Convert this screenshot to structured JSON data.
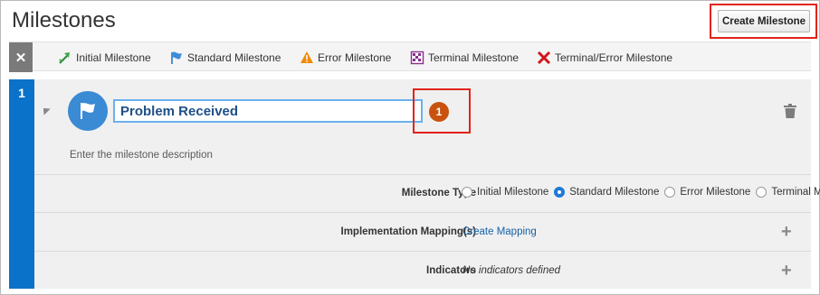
{
  "page": {
    "title": "Milestones"
  },
  "toolbar": {
    "create_milestone_label": "Create Milestone"
  },
  "legend": {
    "close_glyph": "✕",
    "items": [
      {
        "label": "Initial Milestone",
        "icon": "initial-milestone-icon"
      },
      {
        "label": "Standard Milestone",
        "icon": "standard-milestone-icon"
      },
      {
        "label": "Error Milestone",
        "icon": "error-milestone-icon"
      },
      {
        "label": "Terminal Milestone",
        "icon": "terminal-milestone-icon"
      },
      {
        "label": "Terminal/Error Milestone",
        "icon": "terminal-error-milestone-icon"
      }
    ]
  },
  "milestone": {
    "number": "1",
    "name": "Problem Received",
    "badge": "1",
    "description_placeholder": "Enter the milestone description",
    "type_label": "Milestone Type",
    "type_options": [
      "Initial Milestone",
      "Standard Milestone",
      "Error Milestone",
      "Terminal M"
    ],
    "type_selected": "Standard Milestone",
    "mapping_label": "Implementation Mapping(s)",
    "mapping_link": "Create Mapping",
    "indicators_label": "Indicators",
    "indicators_value": "No indicators defined"
  },
  "colors": {
    "accent_blue": "#0a72c9",
    "link_blue": "#1561a8",
    "highlight_red": "#e2231a",
    "badge_orange": "#c8520e"
  }
}
